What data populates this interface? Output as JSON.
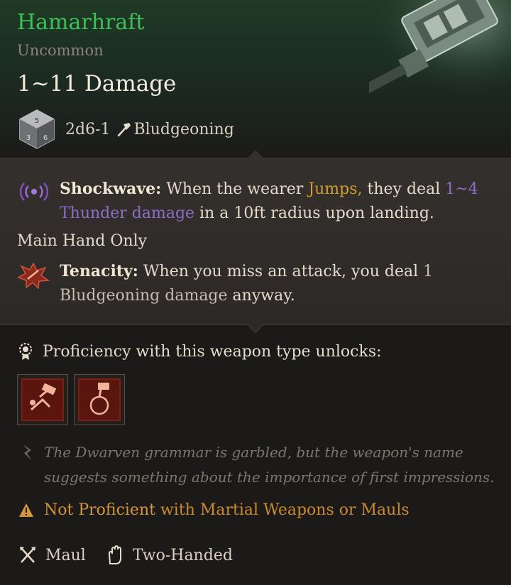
{
  "item": {
    "name": "Hamarhraft",
    "rarity": "Uncommon",
    "damage": "1~11 Damage",
    "dice": "2d6-1",
    "damage_type": "Bludgeoning"
  },
  "passives": [
    {
      "name": "Shockwave:",
      "text_a": "When the wearer",
      "keyword": "Jumps,",
      "text_b": "they deal",
      "highlight": "1~4",
      "highlight2": "Thunder damage",
      "text_c": "in a 10ft radius upon landing."
    },
    {
      "name": "Tenacity:",
      "text_a": "When you miss an attack, you deal",
      "value": "1",
      "value_text": "Bludgeoning damage",
      "text_b": "anyway."
    }
  ],
  "restriction": "Main Hand Only",
  "proficiency": {
    "label": "Proficiency with this weapon type unlocks:",
    "unlock_icons": [
      "prone-strike-icon",
      "concussive-smash-icon"
    ]
  },
  "flavor": "The Dwarven grammar is garbled, but the weapon's name suggests something about the importance of first impressions.",
  "warning": {
    "prefix": "Not Proficient",
    "suffix": "with Martial Weapons or Mauls"
  },
  "footer": {
    "weapon_type": "Maul",
    "handedness": "Two-Handed"
  },
  "colors": {
    "item_name": "#3fbf58",
    "thunder": "#8a6ec6",
    "warning": "#d4963a"
  }
}
